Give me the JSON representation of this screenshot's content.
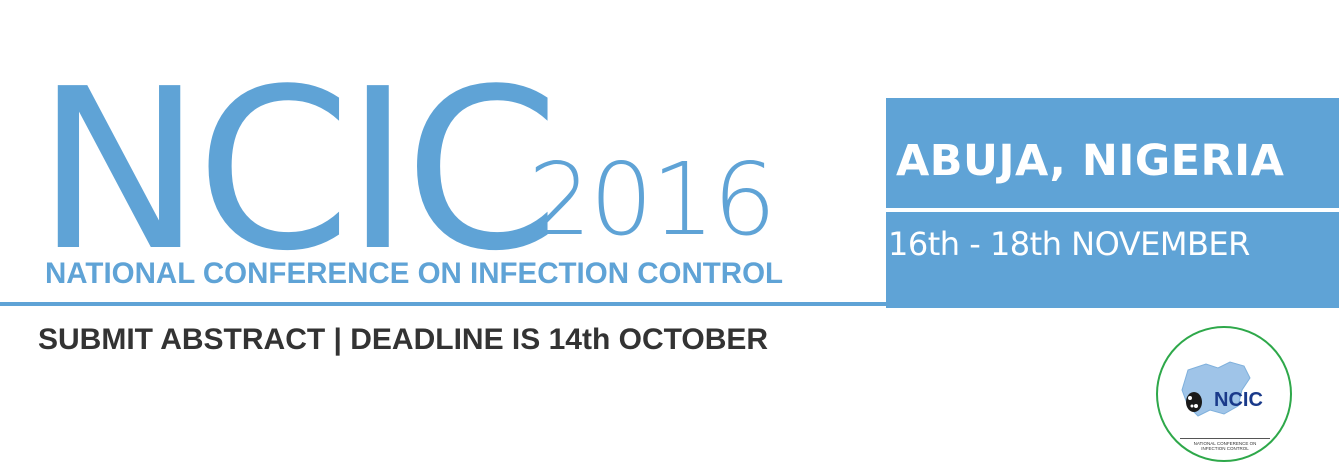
{
  "banner": {
    "acronym": "NCIC",
    "year": "2016",
    "subtitle": "NATIONAL CONFERENCE ON INFECTION CONTROL",
    "call_to_action": "SUBMIT ABSTRACT | DEADLINE IS 14th OCTOBER",
    "location": "ABUJA, NIGERIA",
    "dates": "16th - 18th NOVEMBER",
    "accent_color": "#5fa3d6",
    "text_color": "#333333"
  },
  "logo": {
    "text": "NCIC",
    "caption_line1": "NATIONAL CONFERENCE ON",
    "caption_line2": "INFECTION CONTROL",
    "ring_color": "#2ea84a",
    "map_color": "#9fc4e8"
  }
}
